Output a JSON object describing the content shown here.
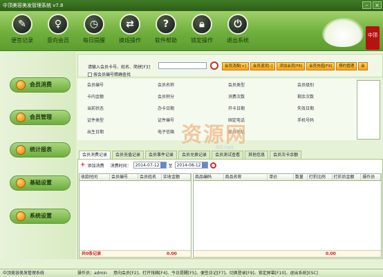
{
  "window": {
    "title": "中顶美容美发管理系统 v7.8"
  },
  "toolbar": [
    {
      "label": "便签记录",
      "icon": "note-icon"
    },
    {
      "label": "意向会员",
      "icon": "member-icon"
    },
    {
      "label": "每日提醒",
      "icon": "alarm-clock-icon"
    },
    {
      "label": "换班操作",
      "icon": "swap-icon"
    },
    {
      "label": "软件帮助",
      "icon": "help-icon"
    },
    {
      "label": "锁定操作",
      "icon": "lock-icon"
    },
    {
      "label": "退出系统",
      "icon": "power-icon"
    }
  ],
  "brand_logo": "中顶",
  "sidebar": [
    {
      "label": "会员消费"
    },
    {
      "label": "会员管理"
    },
    {
      "label": "统计报表"
    },
    {
      "label": "基础设置"
    },
    {
      "label": "系统设置"
    }
  ],
  "search": {
    "label": "请输入会员卡号、姓名、简拼[F3]",
    "value": "",
    "exact_label": "按会员编号精确查找",
    "buttons": [
      "会员消费[+]",
      "会员退货[-]",
      "添加会员[F8]",
      "会员充值[F9]",
      "预约管理",
      "会"
    ]
  },
  "info_fields": [
    [
      "会员编号",
      "会员名称",
      "会员类型",
      "会员级别"
    ],
    [
      "卡内金额",
      "会员积分",
      "消费次数",
      "剩余次数"
    ],
    [
      "当前状态",
      "办卡日期",
      "开卡日期",
      "失效日期"
    ],
    [
      "证件类型",
      "证件编号",
      "固定电话",
      "手机号码"
    ],
    [
      "出生日期",
      "电子信箱",
      "联系地址",
      ""
    ]
  ],
  "watermark": {
    "main": "资源网",
    "sub": "90.net"
  },
  "tabs": [
    "会员消费记录",
    "会员充值记录",
    "会员事件记录",
    "会员兑换记录",
    "会员测试查看",
    "其他信息",
    "会员次卡余额"
  ],
  "panel": {
    "add_label": "添加消费",
    "time_label": "消费时间：",
    "date_from": "2014-07-12",
    "to_label": "至",
    "date_to": "2014-08-12"
  },
  "left_grid": {
    "columns": [
      "收款时间",
      "会员编号",
      "会员姓名",
      "实收金额"
    ],
    "footer_count": "共0条记录",
    "footer_total": "0.00"
  },
  "right_grid": {
    "columns": [
      "商品编码",
      "商品名称",
      "单价",
      "数量",
      "打折比例",
      "打折后金额",
      "操作员"
    ],
    "footer_total": "0.00"
  },
  "status": {
    "app": "中顶美容美发管理系统",
    "operator": "操作员：admin",
    "shortcuts": "意向会员[F2]、打开钱箱[F4]、今日提醒[F5]、便签日记[F7]、切换登录[F9]、锁定屏幕[F10]、退出系统[ESC]"
  }
}
